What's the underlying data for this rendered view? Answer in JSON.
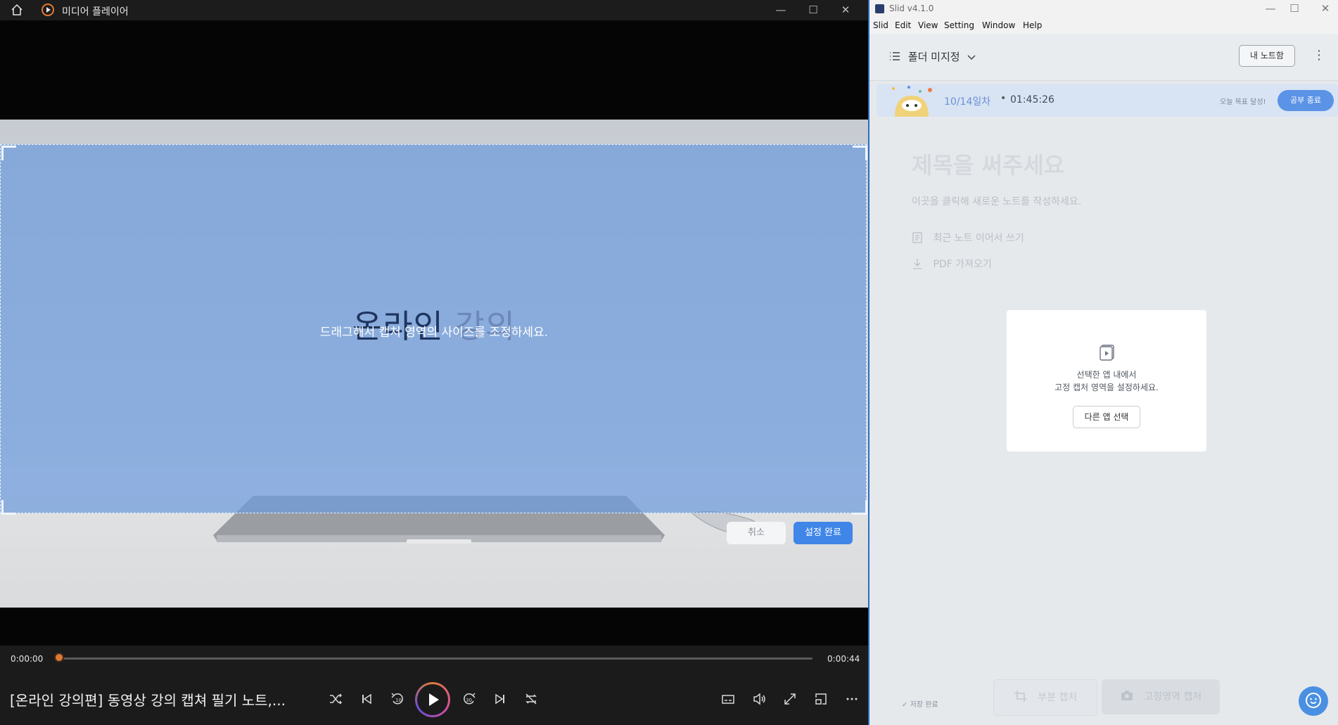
{
  "media_player": {
    "title": "미디어 플레이어",
    "window_controls": {
      "minimize": "—",
      "maximize": "☐",
      "close": "✕"
    },
    "selection": {
      "overlay_text_bold": "온라인",
      "overlay_text_light": "강의",
      "hint": "드래그해서 캡처 영역의 사이즈를 조정하세요.",
      "cancel_label": "취소",
      "confirm_label": "설정 완료"
    },
    "controls": {
      "time_current": "0:00:00",
      "time_total": "0:00:44",
      "progress": 0,
      "video_title": "[온라인 강의편] 동영상 강의 캡쳐 필기 노트,..."
    }
  },
  "slid": {
    "title": "Slid v4.1.0",
    "window_controls": {
      "minimize": "—",
      "maximize": "☐",
      "close": "✕"
    },
    "menu": [
      "Slid",
      "Edit",
      "View",
      "Setting",
      "Window",
      "Help"
    ],
    "folder_label": "폴더 미지정",
    "my_notes_label": "내 노트함",
    "study": {
      "day_label": "10/14일차",
      "timer": "01:45:26",
      "goal_label": "오늘 목표 달성!",
      "end_label": "공부 종료"
    },
    "note": {
      "title_placeholder": "제목을 써주세요",
      "body_placeholder": "이곳을 클릭해 새로운 노트를 작성하세요.",
      "continue_recent_label": "최근 노트 이어서 쓰기",
      "import_pdf_label": "PDF 가져오기"
    },
    "fixed_capture_card": {
      "line1": "선택한 앱 내에서",
      "line2": "고정 캡처 영역을 설정하세요.",
      "button_label": "다른 앱 선택"
    },
    "footer": {
      "saved_label": "저장 완료",
      "partial_capture_label": "부분 캡처",
      "fixed_capture_label": "고정영역 캡처"
    },
    "accent_color": "#5b93e6"
  }
}
